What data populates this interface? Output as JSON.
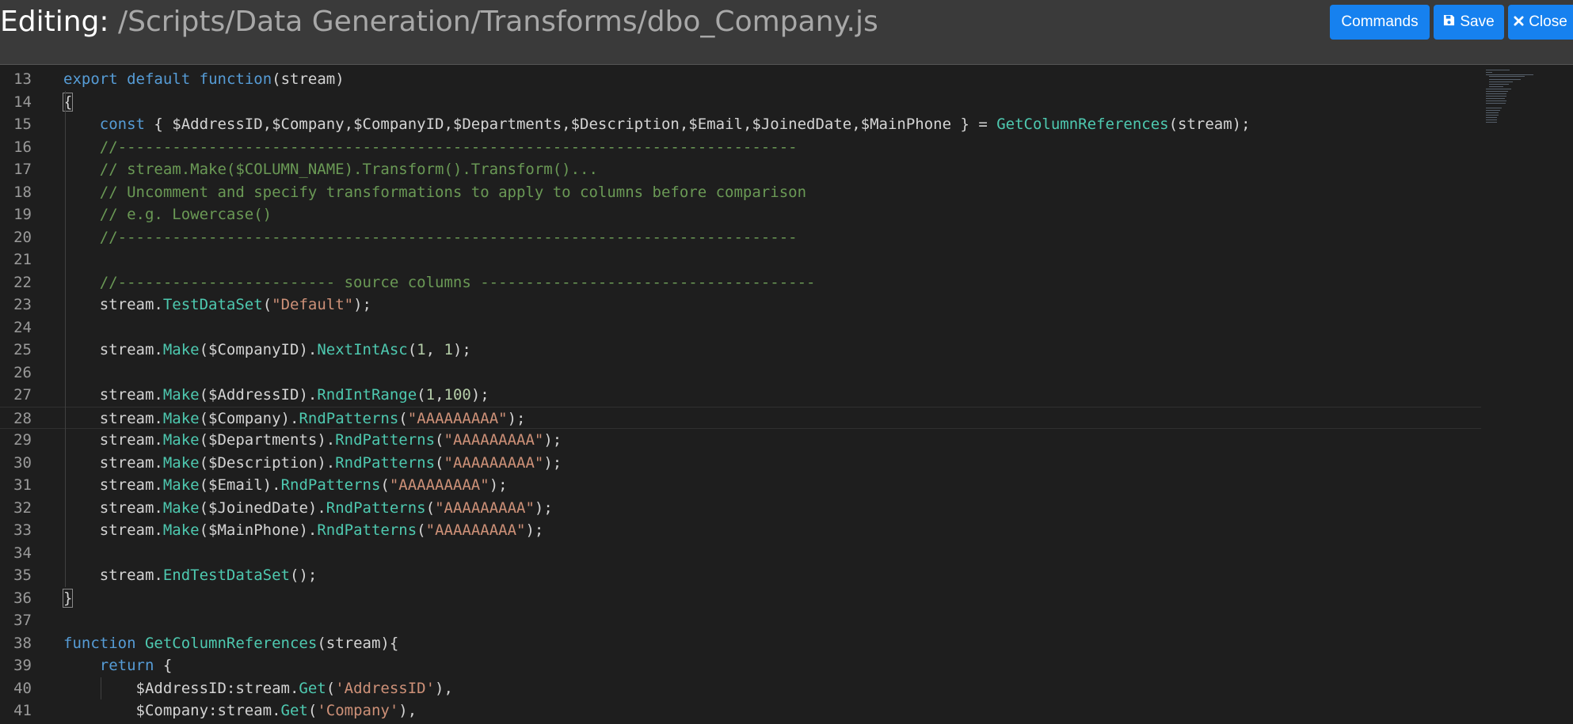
{
  "header": {
    "label": "Editing:",
    "path": " /Scripts/Data Generation/Transforms/dbo_Company.js",
    "buttons": {
      "commands": "Commands",
      "save": "Save",
      "close": "Close"
    },
    "accent_color": "#1681ef"
  },
  "editor": {
    "lines": [
      {
        "n": "13",
        "t": [
          [
            "kw",
            "export"
          ],
          [
            "p",
            " "
          ],
          [
            "kw",
            "default"
          ],
          [
            "p",
            " "
          ],
          [
            "kw",
            "function"
          ],
          [
            "p",
            "(stream)"
          ]
        ]
      },
      {
        "n": "14",
        "t": [
          [
            "brk",
            "{"
          ]
        ]
      },
      {
        "n": "15",
        "t": [
          [
            "p",
            "    "
          ],
          [
            "kw",
            "const"
          ],
          [
            "p",
            " { $AddressID,$Company,$CompanyID,$Departments,$Description,$Email,$JoinedDate,$MainPhone } = "
          ],
          [
            "fn",
            "GetColumnReferences"
          ],
          [
            "p",
            "(stream);"
          ]
        ]
      },
      {
        "n": "16",
        "t": [
          [
            "p",
            "    "
          ],
          [
            "cm",
            "//---------------------------------------------------------------------------"
          ]
        ]
      },
      {
        "n": "17",
        "t": [
          [
            "p",
            "    "
          ],
          [
            "cm",
            "// stream.Make($COLUMN_NAME).Transform().Transform()..."
          ]
        ]
      },
      {
        "n": "18",
        "t": [
          [
            "p",
            "    "
          ],
          [
            "cm",
            "// Uncomment and specify transformations to apply to columns before comparison"
          ]
        ]
      },
      {
        "n": "19",
        "t": [
          [
            "p",
            "    "
          ],
          [
            "cm",
            "// e.g. Lowercase()"
          ]
        ]
      },
      {
        "n": "20",
        "t": [
          [
            "p",
            "    "
          ],
          [
            "cm",
            "//---------------------------------------------------------------------------"
          ]
        ]
      },
      {
        "n": "21",
        "t": []
      },
      {
        "n": "22",
        "t": [
          [
            "p",
            "    "
          ],
          [
            "cm",
            "//------------------------ source columns -------------------------------------"
          ]
        ]
      },
      {
        "n": "23",
        "t": [
          [
            "p",
            "    stream."
          ],
          [
            "fn",
            "TestDataSet"
          ],
          [
            "p",
            "("
          ],
          [
            "str",
            "\"Default\""
          ],
          [
            "p",
            ");"
          ]
        ]
      },
      {
        "n": "24",
        "t": []
      },
      {
        "n": "25",
        "t": [
          [
            "p",
            "    stream."
          ],
          [
            "fn",
            "Make"
          ],
          [
            "p",
            "($CompanyID)."
          ],
          [
            "fn",
            "NextIntAsc"
          ],
          [
            "p",
            "("
          ],
          [
            "nm",
            "1"
          ],
          [
            "p",
            ", "
          ],
          [
            "nm",
            "1"
          ],
          [
            "p",
            ");"
          ]
        ]
      },
      {
        "n": "26",
        "t": []
      },
      {
        "n": "27",
        "t": [
          [
            "p",
            "    stream."
          ],
          [
            "fn",
            "Make"
          ],
          [
            "p",
            "($AddressID)."
          ],
          [
            "fn",
            "RndIntRange"
          ],
          [
            "p",
            "("
          ],
          [
            "nm",
            "1"
          ],
          [
            "p",
            ","
          ],
          [
            "nm",
            "100"
          ],
          [
            "p",
            ");"
          ]
        ]
      },
      {
        "n": "28",
        "t": [
          [
            "p",
            "    stream."
          ],
          [
            "fn",
            "Make"
          ],
          [
            "p",
            "($Company)."
          ],
          [
            "fn",
            "RndPatterns"
          ],
          [
            "p",
            "("
          ],
          [
            "str",
            "\"AAAAAAAAA\""
          ],
          [
            "p",
            ");"
          ]
        ],
        "active": true
      },
      {
        "n": "29",
        "t": [
          [
            "p",
            "    stream."
          ],
          [
            "fn",
            "Make"
          ],
          [
            "p",
            "($Departments)."
          ],
          [
            "fn",
            "RndPatterns"
          ],
          [
            "p",
            "("
          ],
          [
            "str",
            "\"AAAAAAAAA\""
          ],
          [
            "p",
            ");"
          ]
        ]
      },
      {
        "n": "30",
        "t": [
          [
            "p",
            "    stream."
          ],
          [
            "fn",
            "Make"
          ],
          [
            "p",
            "($Description)."
          ],
          [
            "fn",
            "RndPatterns"
          ],
          [
            "p",
            "("
          ],
          [
            "str",
            "\"AAAAAAAAA\""
          ],
          [
            "p",
            ");"
          ]
        ]
      },
      {
        "n": "31",
        "t": [
          [
            "p",
            "    stream."
          ],
          [
            "fn",
            "Make"
          ],
          [
            "p",
            "($Email)."
          ],
          [
            "fn",
            "RndPatterns"
          ],
          [
            "p",
            "("
          ],
          [
            "str",
            "\"AAAAAAAAA\""
          ],
          [
            "p",
            ");"
          ]
        ]
      },
      {
        "n": "32",
        "t": [
          [
            "p",
            "    stream."
          ],
          [
            "fn",
            "Make"
          ],
          [
            "p",
            "($JoinedDate)."
          ],
          [
            "fn",
            "RndPatterns"
          ],
          [
            "p",
            "("
          ],
          [
            "str",
            "\"AAAAAAAAA\""
          ],
          [
            "p",
            ");"
          ]
        ]
      },
      {
        "n": "33",
        "t": [
          [
            "p",
            "    stream."
          ],
          [
            "fn",
            "Make"
          ],
          [
            "p",
            "($MainPhone)."
          ],
          [
            "fn",
            "RndPatterns"
          ],
          [
            "p",
            "("
          ],
          [
            "str",
            "\"AAAAAAAAA\""
          ],
          [
            "p",
            ");"
          ]
        ]
      },
      {
        "n": "34",
        "t": []
      },
      {
        "n": "35",
        "t": [
          [
            "p",
            "    stream."
          ],
          [
            "fn",
            "EndTestDataSet"
          ],
          [
            "p",
            "();"
          ]
        ]
      },
      {
        "n": "36",
        "t": [
          [
            "brk",
            "}"
          ]
        ]
      },
      {
        "n": "37",
        "t": []
      },
      {
        "n": "38",
        "t": [
          [
            "kw",
            "function"
          ],
          [
            "p",
            " "
          ],
          [
            "fn",
            "GetColumnReferences"
          ],
          [
            "p",
            "(stream){"
          ]
        ]
      },
      {
        "n": "39",
        "t": [
          [
            "p",
            "    "
          ],
          [
            "kw",
            "return"
          ],
          [
            "p",
            " {"
          ]
        ]
      },
      {
        "n": "40",
        "t": [
          [
            "p",
            "        $AddressID:stream."
          ],
          [
            "fn",
            "Get"
          ],
          [
            "p",
            "("
          ],
          [
            "str",
            "'AddressID'"
          ],
          [
            "p",
            "),"
          ]
        ]
      },
      {
        "n": "41",
        "t": [
          [
            "p",
            "        $Company:stream."
          ],
          [
            "fn",
            "Get"
          ],
          [
            "p",
            "("
          ],
          [
            "str",
            "'Company'"
          ],
          [
            "p",
            "),"
          ]
        ]
      }
    ]
  }
}
